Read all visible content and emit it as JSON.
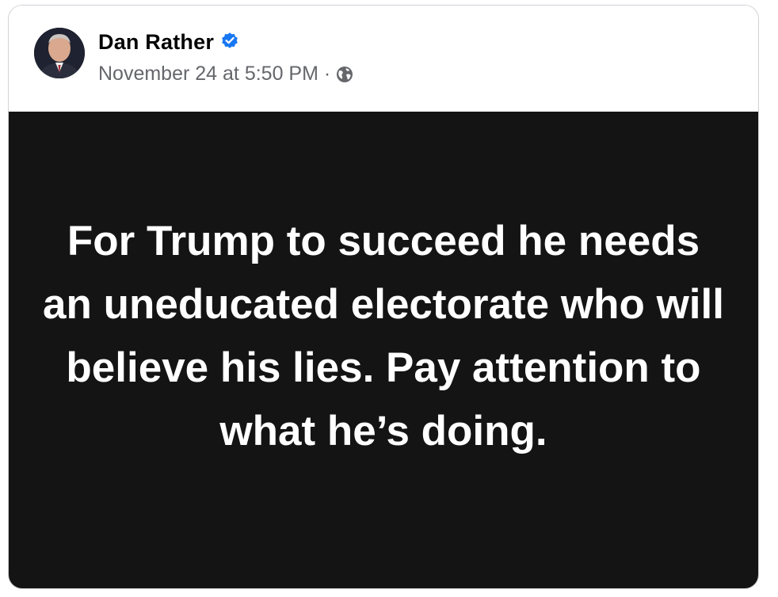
{
  "post": {
    "author": {
      "name": "Dan Rather",
      "verified": true,
      "verified_icon": "verified-badge-icon",
      "avatar_icon": "avatar"
    },
    "meta": {
      "timestamp": "November 24 at 5:50 PM",
      "separator": "·",
      "audience_icon": "globe-icon"
    },
    "body": {
      "text": "For Trump to succeed he needs an uneducated electorate who will believe his lies. Pay attention to what he’s doing.",
      "background_color": "#141414",
      "text_color": "#ffffff"
    }
  },
  "colors": {
    "verified_blue": "#1877f2",
    "meta_gray": "#65676b",
    "name_black": "#050505"
  }
}
